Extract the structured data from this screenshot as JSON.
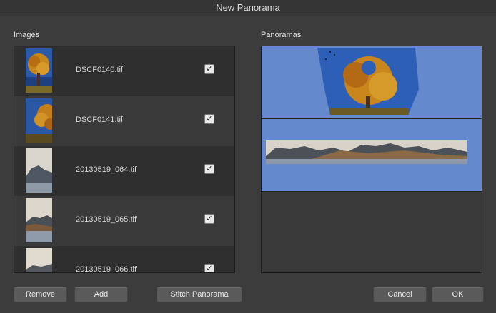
{
  "window": {
    "title": "New Panorama"
  },
  "images": {
    "label": "Images",
    "items": [
      {
        "filename": "DSCF0140.tif",
        "checked": "✓",
        "thumb": "autumn-tree"
      },
      {
        "filename": "DSCF0141.tif",
        "checked": "✓",
        "thumb": "autumn-tree-right"
      },
      {
        "filename": "20130519_064.tif",
        "checked": "✓",
        "thumb": "mountain-sea"
      },
      {
        "filename": "20130519_065.tif",
        "checked": "✓",
        "thumb": "mountain-sea"
      },
      {
        "filename": "20130519_066.tif",
        "checked": "✓",
        "thumb": "mountain-sea"
      }
    ]
  },
  "panoramas": {
    "label": "Panoramas",
    "items": [
      {
        "preview": "autumn-tree-panorama"
      },
      {
        "preview": "mountain-coast-panorama"
      }
    ]
  },
  "buttons": {
    "remove": "Remove",
    "add": "Add",
    "stitch": "Stitch Panorama",
    "cancel": "Cancel",
    "ok": "OK"
  },
  "colors": {
    "panorama_background": "#6489cc",
    "window_background": "#3c3c3c"
  }
}
